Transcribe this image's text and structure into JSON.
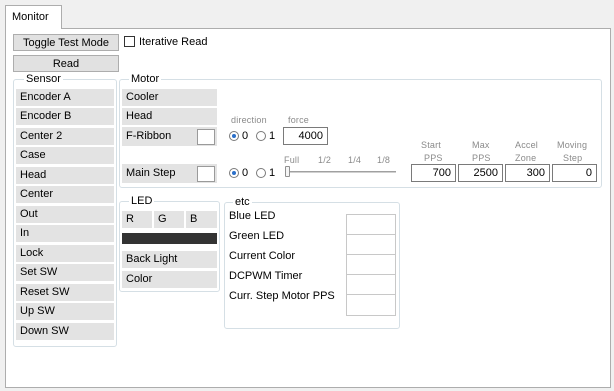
{
  "tab": {
    "label": "Monitor"
  },
  "toolbar": {
    "toggle_label": "Toggle Test Mode",
    "iterative_label": "Iterative Read",
    "read_label": "Read"
  },
  "sensor": {
    "title": "Sensor",
    "items": [
      "Encoder A",
      "Encoder B",
      "Center 2",
      "Case",
      "Head",
      "Center",
      "Out",
      "In",
      "Lock",
      "Set SW",
      "Reset SW",
      "Up SW",
      "Down SW"
    ]
  },
  "motor": {
    "title": "Motor",
    "cooler": "Cooler",
    "head": "Head",
    "fribbon": "F-Ribbon",
    "mainstep": "Main Step",
    "direction_label": "direction",
    "force_label": "force",
    "radio0": "0",
    "radio1": "1",
    "force_value": "4000",
    "step_full": "Full",
    "step_half": "1/2",
    "step_quarter": "1/4",
    "step_eighth": "1/8",
    "col_start": [
      "Start",
      "PPS"
    ],
    "col_max": [
      "Max",
      "PPS"
    ],
    "col_accel": [
      "Accel",
      "Zone"
    ],
    "col_moving": [
      "Moving",
      "Step"
    ],
    "start_pps": "700",
    "max_pps": "2500",
    "accel_zone": "300",
    "moving_step": "0"
  },
  "led": {
    "title": "LED",
    "r": "R",
    "g": "G",
    "b": "B",
    "bar_color": "#333333",
    "backlight": "Back Light",
    "color": "Color"
  },
  "etc": {
    "title": "etc",
    "labels": [
      "Blue LED",
      "Green LED",
      "Current Color",
      "DCPWM Timer",
      "Curr. Step Motor PPS"
    ]
  }
}
